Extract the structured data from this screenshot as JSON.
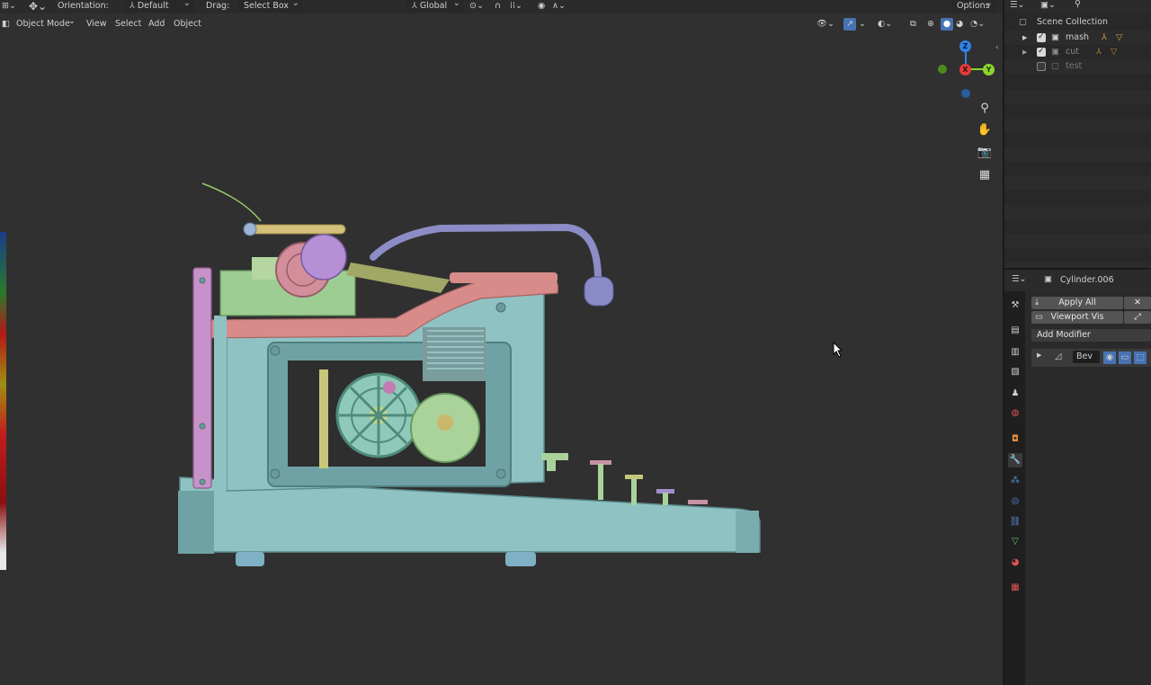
{
  "toolbar": {
    "orientation_label": "Orientation:",
    "orientation_value": "Default",
    "drag_label": "Drag:",
    "drag_value": "Select Box",
    "transform_value": "Global",
    "options_label": "Options"
  },
  "header": {
    "mode_value": "Object Mode",
    "menus": [
      "View",
      "Select",
      "Add",
      "Object"
    ]
  },
  "gizmo": {
    "axes": {
      "z": "Z",
      "x": "X",
      "y": "Y"
    }
  },
  "outliner": {
    "root": "Scene Collection",
    "collections": [
      {
        "name": "mash",
        "checked": true
      },
      {
        "name": "cut",
        "checked": true
      },
      {
        "name": "test",
        "checked": false
      }
    ]
  },
  "properties": {
    "object_name": "Cylinder.006",
    "apply_all_label": "Apply All",
    "viewport_vis_label": "Viewport Vis",
    "add_modifier_label": "Add Modifier",
    "modifier_name": "Bev"
  },
  "colors": {
    "accent_blue": "#4772b3",
    "axis_x": "#e23b3b",
    "axis_y": "#8bd52c",
    "axis_z": "#2f83e8"
  }
}
